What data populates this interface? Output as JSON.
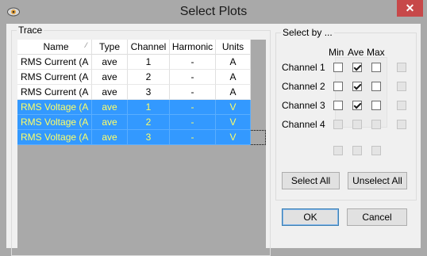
{
  "window": {
    "title": "Select Plots",
    "close_glyph": "✕"
  },
  "trace": {
    "group_label": "Trace",
    "columns": [
      "Name",
      "Type",
      "Channel",
      "Harmonic",
      "Units"
    ],
    "rows": [
      {
        "name": "RMS Current (A",
        "type": "ave",
        "channel": "1",
        "harmonic": "-",
        "units": "A",
        "selected": false
      },
      {
        "name": "RMS Current (A",
        "type": "ave",
        "channel": "2",
        "harmonic": "-",
        "units": "A",
        "selected": false
      },
      {
        "name": "RMS Current (A",
        "type": "ave",
        "channel": "3",
        "harmonic": "-",
        "units": "A",
        "selected": false
      },
      {
        "name": "RMS Voltage (A",
        "type": "ave",
        "channel": "1",
        "harmonic": "-",
        "units": "V",
        "selected": true
      },
      {
        "name": "RMS Voltage (A",
        "type": "ave",
        "channel": "2",
        "harmonic": "-",
        "units": "V",
        "selected": true
      },
      {
        "name": "RMS Voltage (A",
        "type": "ave",
        "channel": "3",
        "harmonic": "-",
        "units": "V",
        "selected": true
      }
    ]
  },
  "select_by": {
    "group_label": "Select by ...",
    "columns": [
      "Min",
      "Ave",
      "Max"
    ],
    "channels": [
      {
        "label": "Channel 1",
        "min": false,
        "ave": true,
        "max": false,
        "enabled": true
      },
      {
        "label": "Channel 2",
        "min": false,
        "ave": true,
        "max": false,
        "enabled": true
      },
      {
        "label": "Channel 3",
        "min": false,
        "ave": true,
        "max": false,
        "enabled": true
      },
      {
        "label": "Channel 4",
        "min": false,
        "ave": false,
        "max": false,
        "enabled": false
      }
    ],
    "select_all_label": "Select All",
    "unselect_all_label": "Unselect All"
  },
  "buttons": {
    "ok": "OK",
    "cancel": "Cancel"
  },
  "colors": {
    "selection": "#3399ff",
    "selection_text": "#ffff66",
    "close_button": "#c74849"
  }
}
